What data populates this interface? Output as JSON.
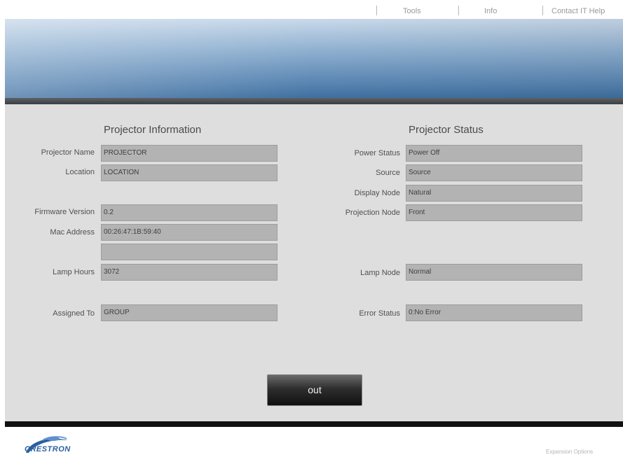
{
  "nav": {
    "tools": "Tools",
    "info": "Info",
    "contact": "Contact IT Help"
  },
  "info": {
    "title": "Projector Information",
    "fields": [
      {
        "label": "Projector Name",
        "value": "PROJECTOR"
      },
      {
        "label": "Location",
        "value": "LOCATION"
      },
      {
        "label": "Firmware Version",
        "value": "0.2"
      },
      {
        "label": "Mac Address",
        "value": "00:26:47:1B:59:40"
      },
      {
        "label": "",
        "value": ""
      },
      {
        "label": "Lamp Hours",
        "value": "3072"
      },
      {
        "label": "Assigned To",
        "value": "GROUP"
      }
    ]
  },
  "status": {
    "title": "Projector Status",
    "fields": [
      {
        "label": "Power Status",
        "value": "Power Off"
      },
      {
        "label": "Source",
        "value": "Source"
      },
      {
        "label": "Display Node",
        "value": "Natural"
      },
      {
        "label": "Projection Node",
        "value": "Front"
      },
      {
        "label": "Lamp Node",
        "value": "Normal"
      },
      {
        "label": "Error Status",
        "value": "0:No Error"
      }
    ]
  },
  "exit_button": "out",
  "footer": {
    "logo_text": "CRESTRON",
    "link": "Expansion Options"
  },
  "colors": {
    "banner": "#5a86b3",
    "panel": "#dedede",
    "field": "#b3b3b3",
    "logo": "#2b5fa0"
  }
}
